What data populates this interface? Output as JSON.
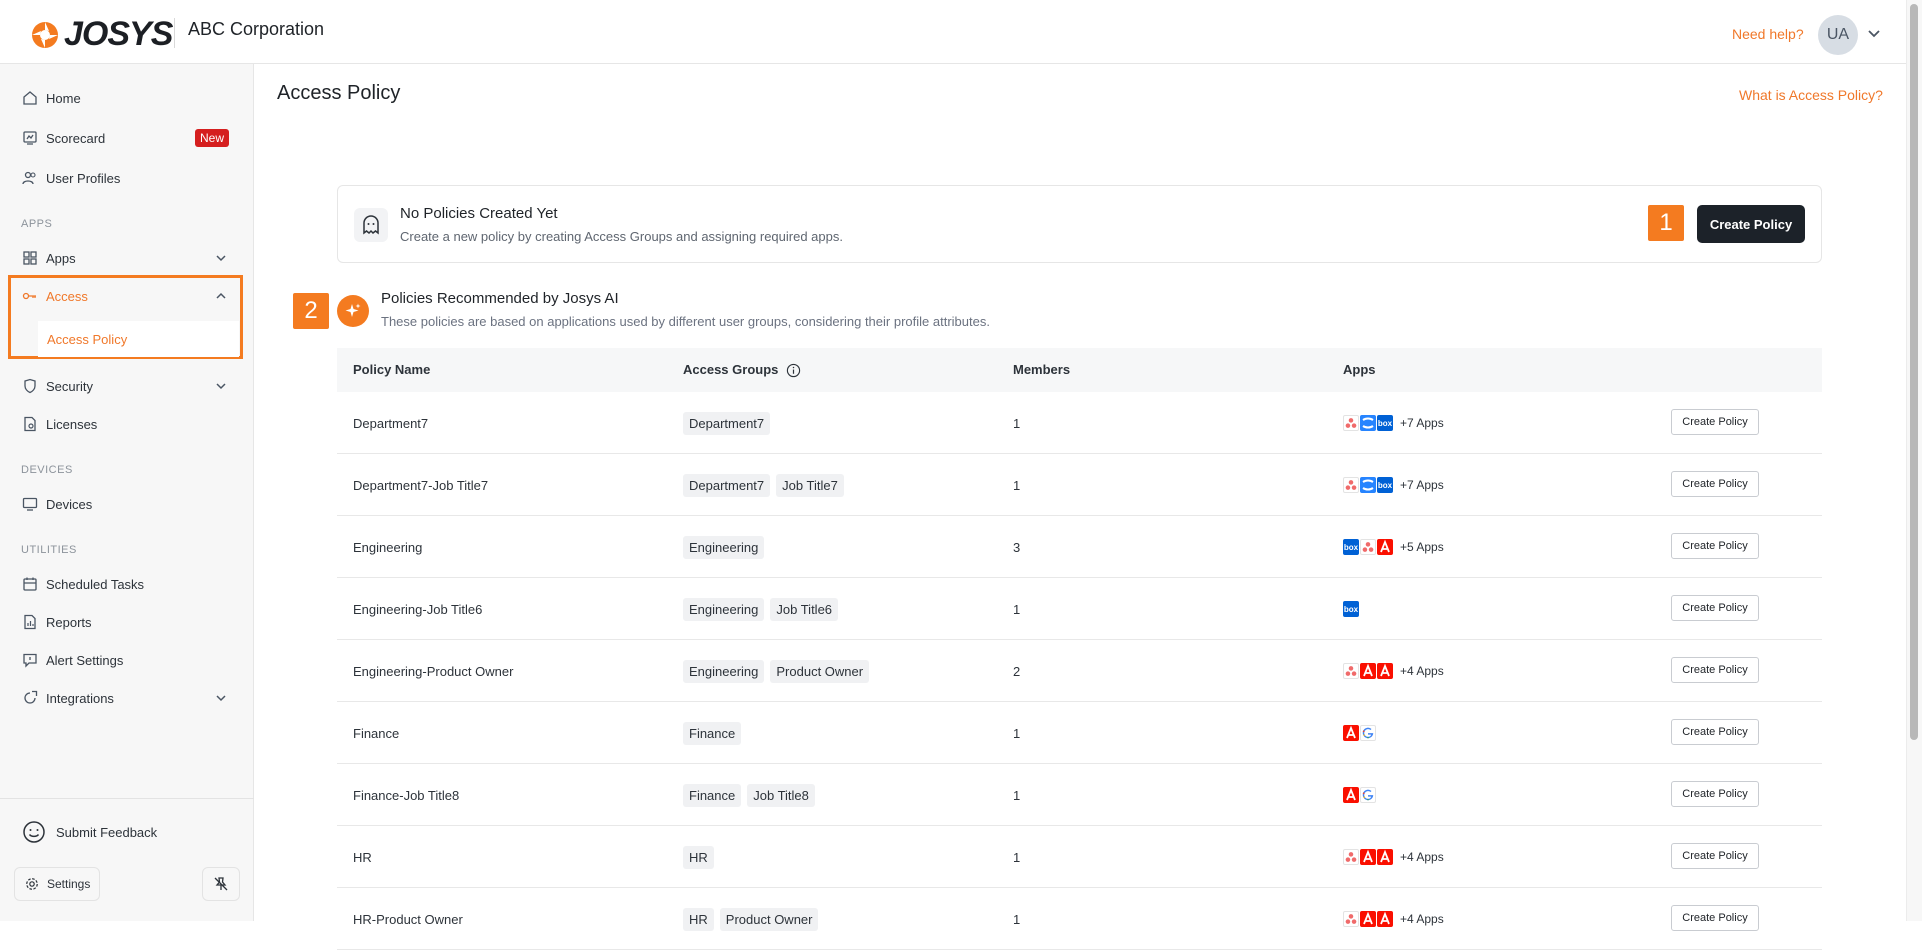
{
  "header": {
    "logo_text": "JOSYS",
    "org_name": "ABC Corporation",
    "need_help": "Need help?",
    "avatar_initials": "UA"
  },
  "sidebar": {
    "items": [
      {
        "label": "Home",
        "icon": "home-icon"
      },
      {
        "label": "Scorecard",
        "icon": "scorecard-icon",
        "badge": "New"
      },
      {
        "label": "User Profiles",
        "icon": "users-icon"
      }
    ],
    "section_apps": "APPS",
    "apps": {
      "label": "Apps",
      "icon": "apps-grid-icon"
    },
    "access": {
      "label": "Access",
      "icon": "key-icon",
      "expanded": true
    },
    "access_policy": {
      "label": "Access Policy"
    },
    "security": {
      "label": "Security",
      "icon": "shield-icon"
    },
    "licenses": {
      "label": "Licenses",
      "icon": "license-icon"
    },
    "section_devices": "DEVICES",
    "devices": {
      "label": "Devices",
      "icon": "monitor-icon"
    },
    "section_utilities": "UTILITIES",
    "utilities": [
      {
        "label": "Scheduled Tasks",
        "icon": "calendar-icon"
      },
      {
        "label": "Reports",
        "icon": "report-icon"
      },
      {
        "label": "Alert Settings",
        "icon": "alert-icon"
      },
      {
        "label": "Integrations",
        "icon": "integrations-icon"
      }
    ],
    "feedback": "Submit Feedback",
    "settings": "Settings"
  },
  "main": {
    "title": "Access Policy",
    "help_link": "What is Access Policy?",
    "empty_state": {
      "title": "No Policies Created Yet",
      "description": "Create a new policy by creating Access Groups and assigning required apps.",
      "button": "Create Policy",
      "step": "1"
    },
    "recommended": {
      "step": "2",
      "title": "Policies Recommended by Josys AI",
      "description": "These policies are based on applications used by different user groups, considering their profile attributes."
    },
    "table": {
      "columns": [
        "Policy Name",
        "Access Groups",
        "Members",
        "Apps"
      ],
      "row_button": "Create Policy",
      "rows": [
        {
          "name": "Department7",
          "groups": [
            "Department7"
          ],
          "members": "1",
          "apps": [
            "asana",
            "confluence",
            "box"
          ],
          "more": "+7 Apps"
        },
        {
          "name": "Department7-Job Title7",
          "groups": [
            "Department7",
            "Job Title7"
          ],
          "members": "1",
          "apps": [
            "asana",
            "confluence",
            "box"
          ],
          "more": "+7 Apps"
        },
        {
          "name": "Engineering",
          "groups": [
            "Engineering"
          ],
          "members": "3",
          "apps": [
            "box",
            "asana",
            "adobe"
          ],
          "more": "+5 Apps"
        },
        {
          "name": "Engineering-Job Title6",
          "groups": [
            "Engineering",
            "Job Title6"
          ],
          "members": "1",
          "apps": [
            "box"
          ],
          "more": ""
        },
        {
          "name": "Engineering-Product Owner",
          "groups": [
            "Engineering",
            "Product Owner"
          ],
          "members": "2",
          "apps": [
            "asana",
            "adobe",
            "adobe"
          ],
          "more": "+4 Apps"
        },
        {
          "name": "Finance",
          "groups": [
            "Finance"
          ],
          "members": "1",
          "apps": [
            "adobe",
            "google"
          ],
          "more": ""
        },
        {
          "name": "Finance-Job Title8",
          "groups": [
            "Finance",
            "Job Title8"
          ],
          "members": "1",
          "apps": [
            "adobe",
            "google"
          ],
          "more": ""
        },
        {
          "name": "HR",
          "groups": [
            "HR"
          ],
          "members": "1",
          "apps": [
            "asana",
            "adobe",
            "adobe"
          ],
          "more": "+4 Apps"
        },
        {
          "name": "HR-Product Owner",
          "groups": [
            "HR",
            "Product Owner"
          ],
          "members": "1",
          "apps": [
            "asana",
            "adobe",
            "adobe"
          ],
          "more": "+4 Apps"
        }
      ]
    }
  },
  "colors": {
    "accent": "#f47b20",
    "primary_button": "#1c2229",
    "badge_new": "#d51f1f"
  }
}
